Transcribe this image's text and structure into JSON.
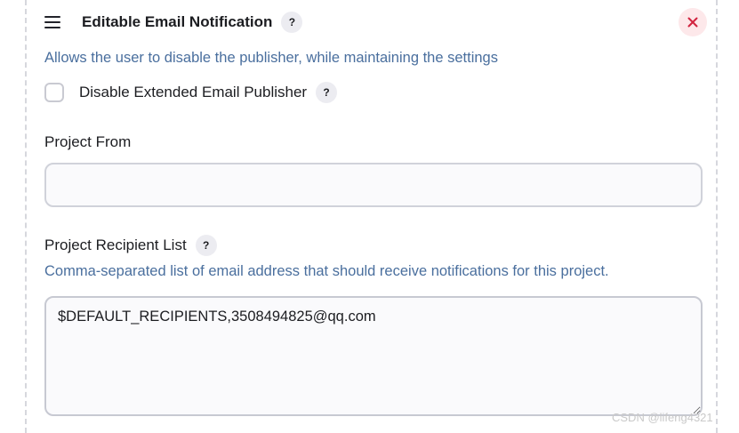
{
  "header": {
    "title": "Editable Email Notification",
    "help_label": "?",
    "close_label": "×"
  },
  "publisher": {
    "description": "Allows the user to disable the publisher, while maintaining the settings",
    "disable_checkbox_label": "Disable Extended Email Publisher",
    "disable_checked": false,
    "help_label": "?"
  },
  "project_from": {
    "label": "Project From",
    "value": "",
    "placeholder": ""
  },
  "project_recipient_list": {
    "label": "Project Recipient List",
    "help_label": "?",
    "description": "Comma-separated list of email address that should receive notifications for this project.",
    "value": "$DEFAULT_RECIPIENTS,3508494825@qq.com"
  },
  "watermark": "CSDN @lifeng4321",
  "colors": {
    "description_text": "#4a6f9e",
    "close_bg": "#fde8ea",
    "close_icon": "#d1243f",
    "help_bg": "#ececf1"
  }
}
